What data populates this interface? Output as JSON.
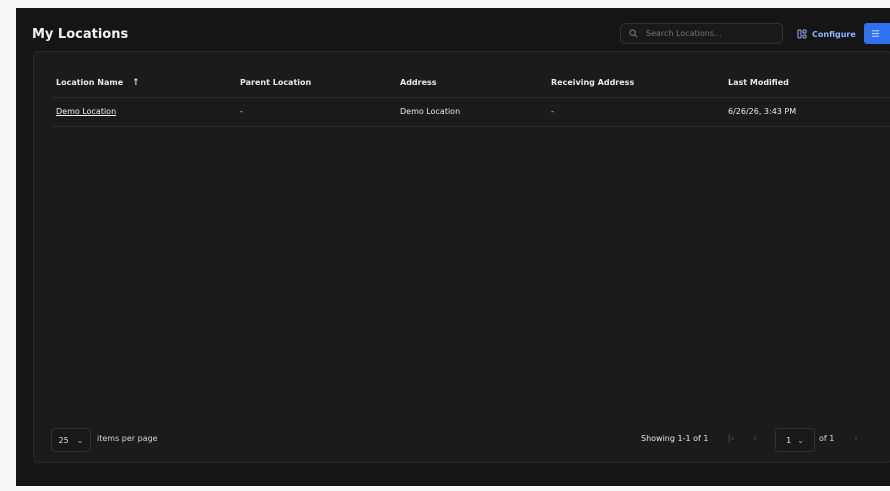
{
  "page": {
    "title": "My Locations"
  },
  "toolbar": {
    "search_placeholder": "Search Locations...",
    "configure_label": "Configure"
  },
  "table": {
    "columns": [
      "Location Name",
      "Parent Location",
      "Address",
      "Receiving Address",
      "Last Modified"
    ],
    "sort_indicator": "↑",
    "rows": [
      {
        "location_name": "Demo Location",
        "parent_location": "-",
        "address": "Demo Location",
        "receiving_address": "-",
        "last_modified": "6/26/26, 3:43 PM"
      }
    ]
  },
  "pagination": {
    "page_size": "25",
    "items_per_page_label": "items per page",
    "showing_text": "Showing 1-1 of 1",
    "current_page": "1",
    "of_label": "of 1"
  },
  "colors": {
    "background": "#151515",
    "card": "#1b1b1b",
    "accent": "#2f72f0",
    "text": "#eaeaea"
  }
}
